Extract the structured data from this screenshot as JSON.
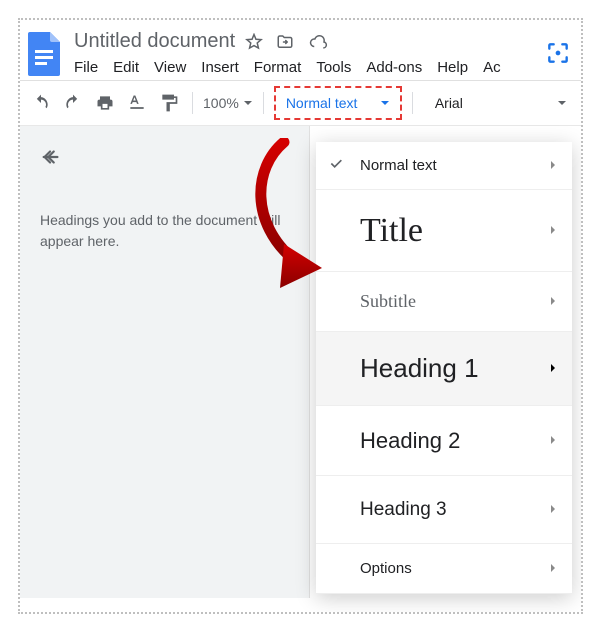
{
  "header": {
    "title": "Untitled document",
    "menu": [
      "File",
      "Edit",
      "View",
      "Insert",
      "Format",
      "Tools",
      "Add-ons",
      "Help",
      "Ac"
    ]
  },
  "toolbar": {
    "zoom": "100%",
    "style_selector": "Normal text",
    "font": "Arial"
  },
  "outline": {
    "placeholder_line1": "Headings you add to the document will",
    "placeholder_line2": "appear here."
  },
  "style_dropdown": {
    "items": [
      {
        "label": "Normal text",
        "checked": true,
        "class": "normal"
      },
      {
        "label": "Title",
        "class": "title"
      },
      {
        "label": "Subtitle",
        "class": "subtitle"
      },
      {
        "label": "Heading 1",
        "class": "h1",
        "hovered": true
      },
      {
        "label": "Heading 2",
        "class": "h2"
      },
      {
        "label": "Heading 3",
        "class": "h3"
      },
      {
        "label": "Options",
        "class": "options"
      }
    ]
  },
  "colors": {
    "highlight": "#e53935",
    "accent": "#1a73e8"
  }
}
